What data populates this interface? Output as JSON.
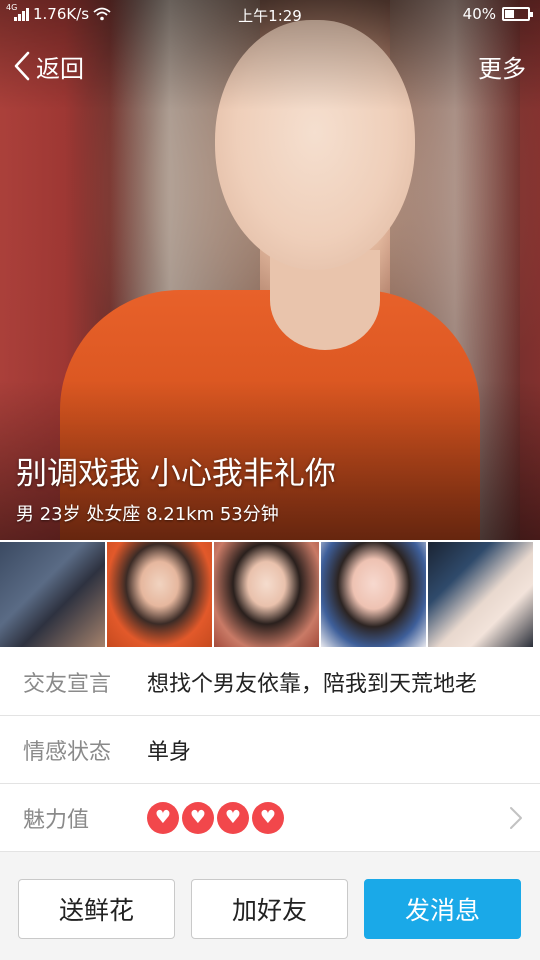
{
  "status_bar": {
    "network_tag": "4G",
    "speed": "1.76K/s",
    "time": "上午1:29",
    "battery_text": "40%",
    "battery_level": 0.4
  },
  "nav": {
    "back_label": "返回",
    "more_label": "更多"
  },
  "profile": {
    "headline": "别调戏我 小心我非礼你",
    "meta": "男 23岁 处女座 8.21km 53分钟"
  },
  "info_rows": [
    {
      "label": "交友宣言",
      "value": "想找个男友依靠，陪我到天荒地老"
    },
    {
      "label": "情感状态",
      "value": "单身"
    },
    {
      "label": "魅力值",
      "hearts": 4
    }
  ],
  "actions": {
    "flower_label": "送鲜花",
    "add_friend_label": "加好友",
    "message_label": "发消息"
  },
  "colors": {
    "accent": "#1aa9e8",
    "heart": "#f2474b"
  }
}
